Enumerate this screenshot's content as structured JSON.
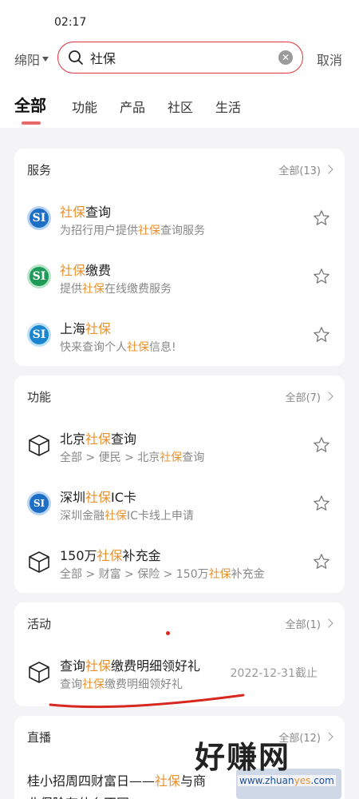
{
  "status": {
    "time": "02:17"
  },
  "header": {
    "city": "绵阳",
    "search_value": "社保",
    "cancel": "取消"
  },
  "tabs": [
    "全部",
    "功能",
    "产品",
    "社区",
    "生活"
  ],
  "services": {
    "title": "服务",
    "more": "全部(13)",
    "items": [
      {
        "pre": "",
        "hl": "社保",
        "post": "查询",
        "d_pre": "为招行用户提供",
        "d_hl": "社保",
        "d_post": "查询服务",
        "icon": "social-security-blue-icon"
      },
      {
        "pre": "",
        "hl": "社保",
        "post": "缴费",
        "d_pre": "提供",
        "d_hl": "社保",
        "d_post": "在线缴费服务",
        "icon": "social-security-green-icon"
      },
      {
        "pre": "上海",
        "hl": "社保",
        "post": "",
        "d_pre": "快来查询个人",
        "d_hl": "社保",
        "d_post": "信息!",
        "icon": "social-security-cyan-icon"
      }
    ]
  },
  "functions": {
    "title": "功能",
    "more": "全部(7)",
    "items": [
      {
        "pre": "北京",
        "hl": "社保",
        "post": "查询",
        "d_pre": "全部 > 便民 > 北京",
        "d_hl": "社保",
        "d_post": "查询",
        "icon": "cube-icon"
      },
      {
        "pre": "深圳",
        "hl": "社保",
        "post": "IC卡",
        "d_pre": "深圳金融",
        "d_hl": "社保",
        "d_post": "IC卡线上申请",
        "icon": "shenzhen-social-security-icon"
      },
      {
        "pre": "150万",
        "hl": "社保",
        "post": "补充金",
        "d_pre": "全部 > 财富 > 保险 > 150万",
        "d_hl": "社保",
        "d_post": "补充金",
        "icon": "cube-icon"
      }
    ]
  },
  "activities": {
    "title": "活动",
    "more": "全部(1)",
    "items": [
      {
        "pre": "查询",
        "hl": "社保",
        "post": "缴费明细领好礼",
        "d_pre": "查询",
        "d_hl": "社保",
        "d_post": "缴费明细领好礼",
        "date": "2022-12-31截止",
        "icon": "cube-icon"
      }
    ]
  },
  "live": {
    "title": "直播",
    "more": "全部(12)",
    "item_title_pre": "桂小招周四财富日——",
    "item_title_hl": "社保",
    "item_title_post": "与商",
    "item_line2": "业保险有什么不同"
  },
  "watermark": {
    "text": "好赚网",
    "url_pre": "www.zhuan",
    "url_hl": "yes",
    "url_post": ".com"
  },
  "colors": {
    "accent": "#e0303c",
    "highlight": "#e8912c"
  }
}
